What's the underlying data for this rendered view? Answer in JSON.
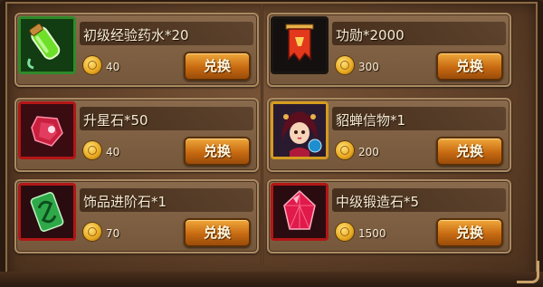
{
  "currency_icon": "gold-coin-icon",
  "button_label": "兑换",
  "items": [
    {
      "title": "初级经验药水*20",
      "price": "40",
      "icon": "green-potion-vial-icon",
      "frame": "#2f8a2a"
    },
    {
      "title": "功勋*2000",
      "price": "300",
      "icon": "banner-flag-icon",
      "frame": "#1a1612"
    },
    {
      "title": "升星石*50",
      "price": "40",
      "icon": "star-gem-icon",
      "frame": "#b21616"
    },
    {
      "title": "貂蝉信物*1",
      "price": "200",
      "icon": "diaochan-portrait-icon",
      "frame": "#d49c1e"
    },
    {
      "title": "饰品进阶石*1",
      "price": "70",
      "icon": "green-jade-stone-icon",
      "frame": "#b21616"
    },
    {
      "title": "中级锻造石*5",
      "price": "1500",
      "icon": "red-crystal-icon",
      "frame": "#b21616"
    }
  ]
}
